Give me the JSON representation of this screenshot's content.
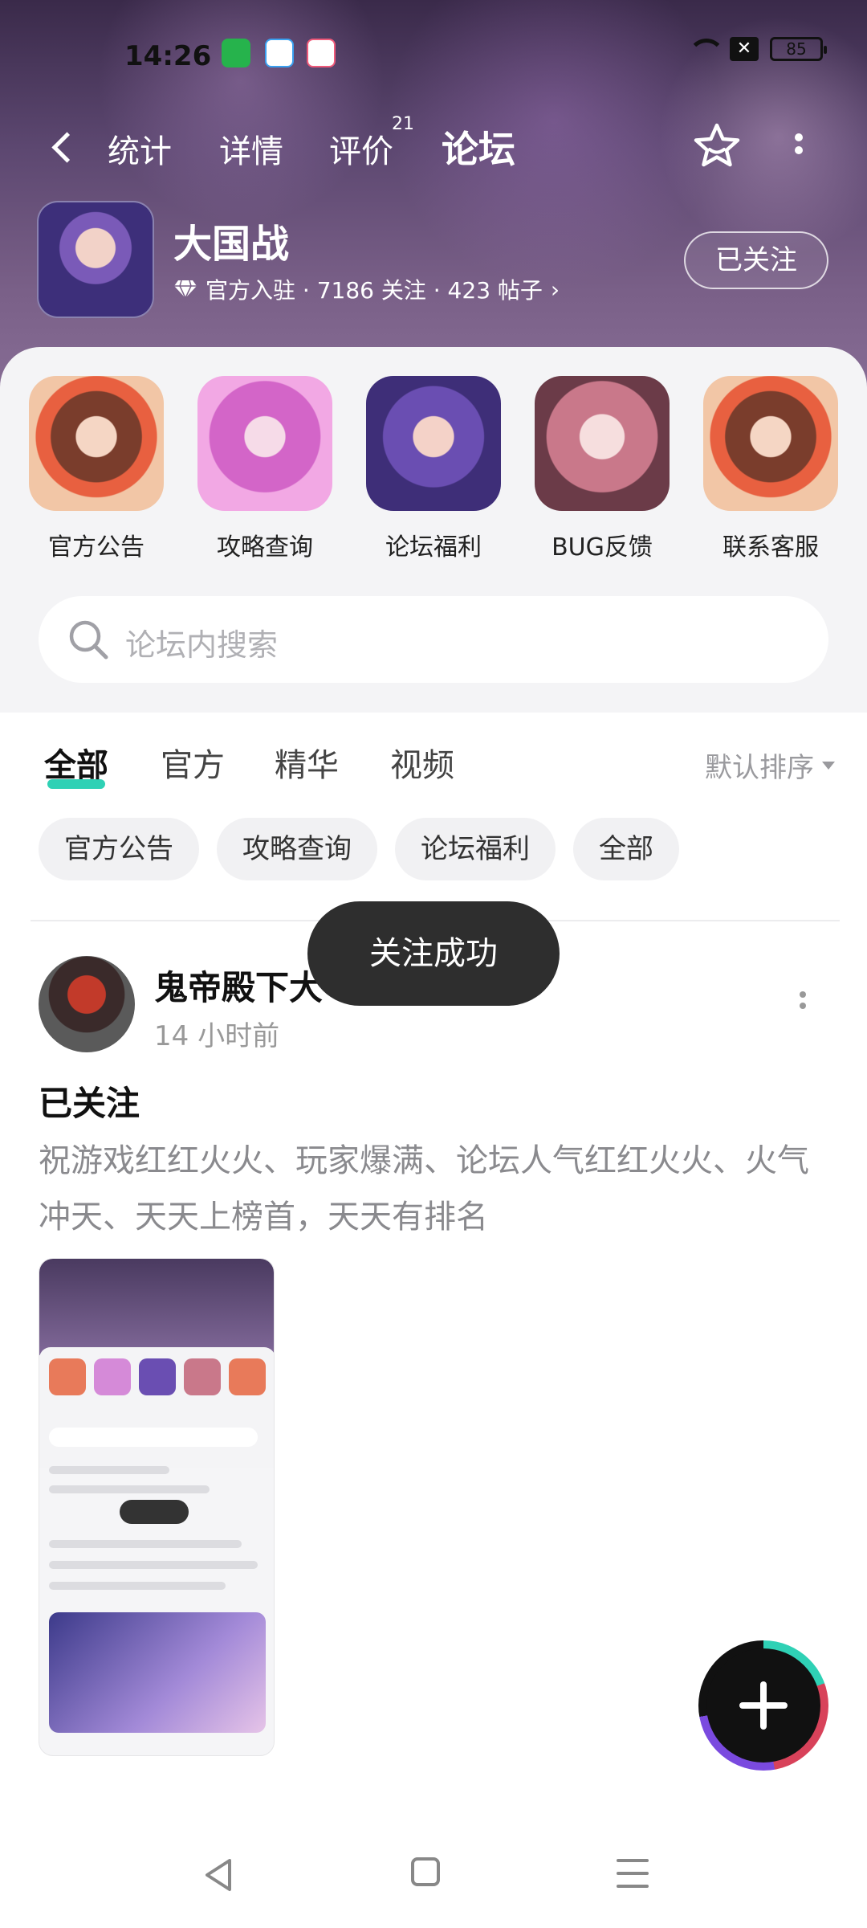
{
  "status_bar": {
    "time": "14:26",
    "battery": "85"
  },
  "top_nav": {
    "tabs": [
      "统计",
      "详情",
      "评价",
      "论坛"
    ],
    "review_badge": "21",
    "active_tab": "论坛"
  },
  "game": {
    "name": "大国战",
    "meta": "官方入驻 · 7186 关注 · 423 帖子",
    "follow_label": "已关注"
  },
  "shortcuts": [
    {
      "label": "官方公告"
    },
    {
      "label": "攻略查询"
    },
    {
      "label": "论坛福利"
    },
    {
      "label": "BUG反馈"
    },
    {
      "label": "联系客服"
    }
  ],
  "search": {
    "placeholder": "论坛内搜索"
  },
  "filter_tabs": {
    "items": [
      "全部",
      "官方",
      "精华",
      "视频"
    ],
    "active": "全部",
    "sort_label": "默认排序"
  },
  "chips": [
    "官方公告",
    "攻略查询",
    "论坛福利",
    "全部"
  ],
  "toast": {
    "text": "关注成功"
  },
  "post": {
    "author": "鬼帝殿下大",
    "time": "14 小时前",
    "title": "已关注",
    "body": "祝游戏红红火火、玩家爆满、论坛人气红红火火、火气冲天、天天上榜首，天天有排名"
  },
  "colors": {
    "accent": "#2fd1b5",
    "toast_bg": "#2e2e2e"
  }
}
